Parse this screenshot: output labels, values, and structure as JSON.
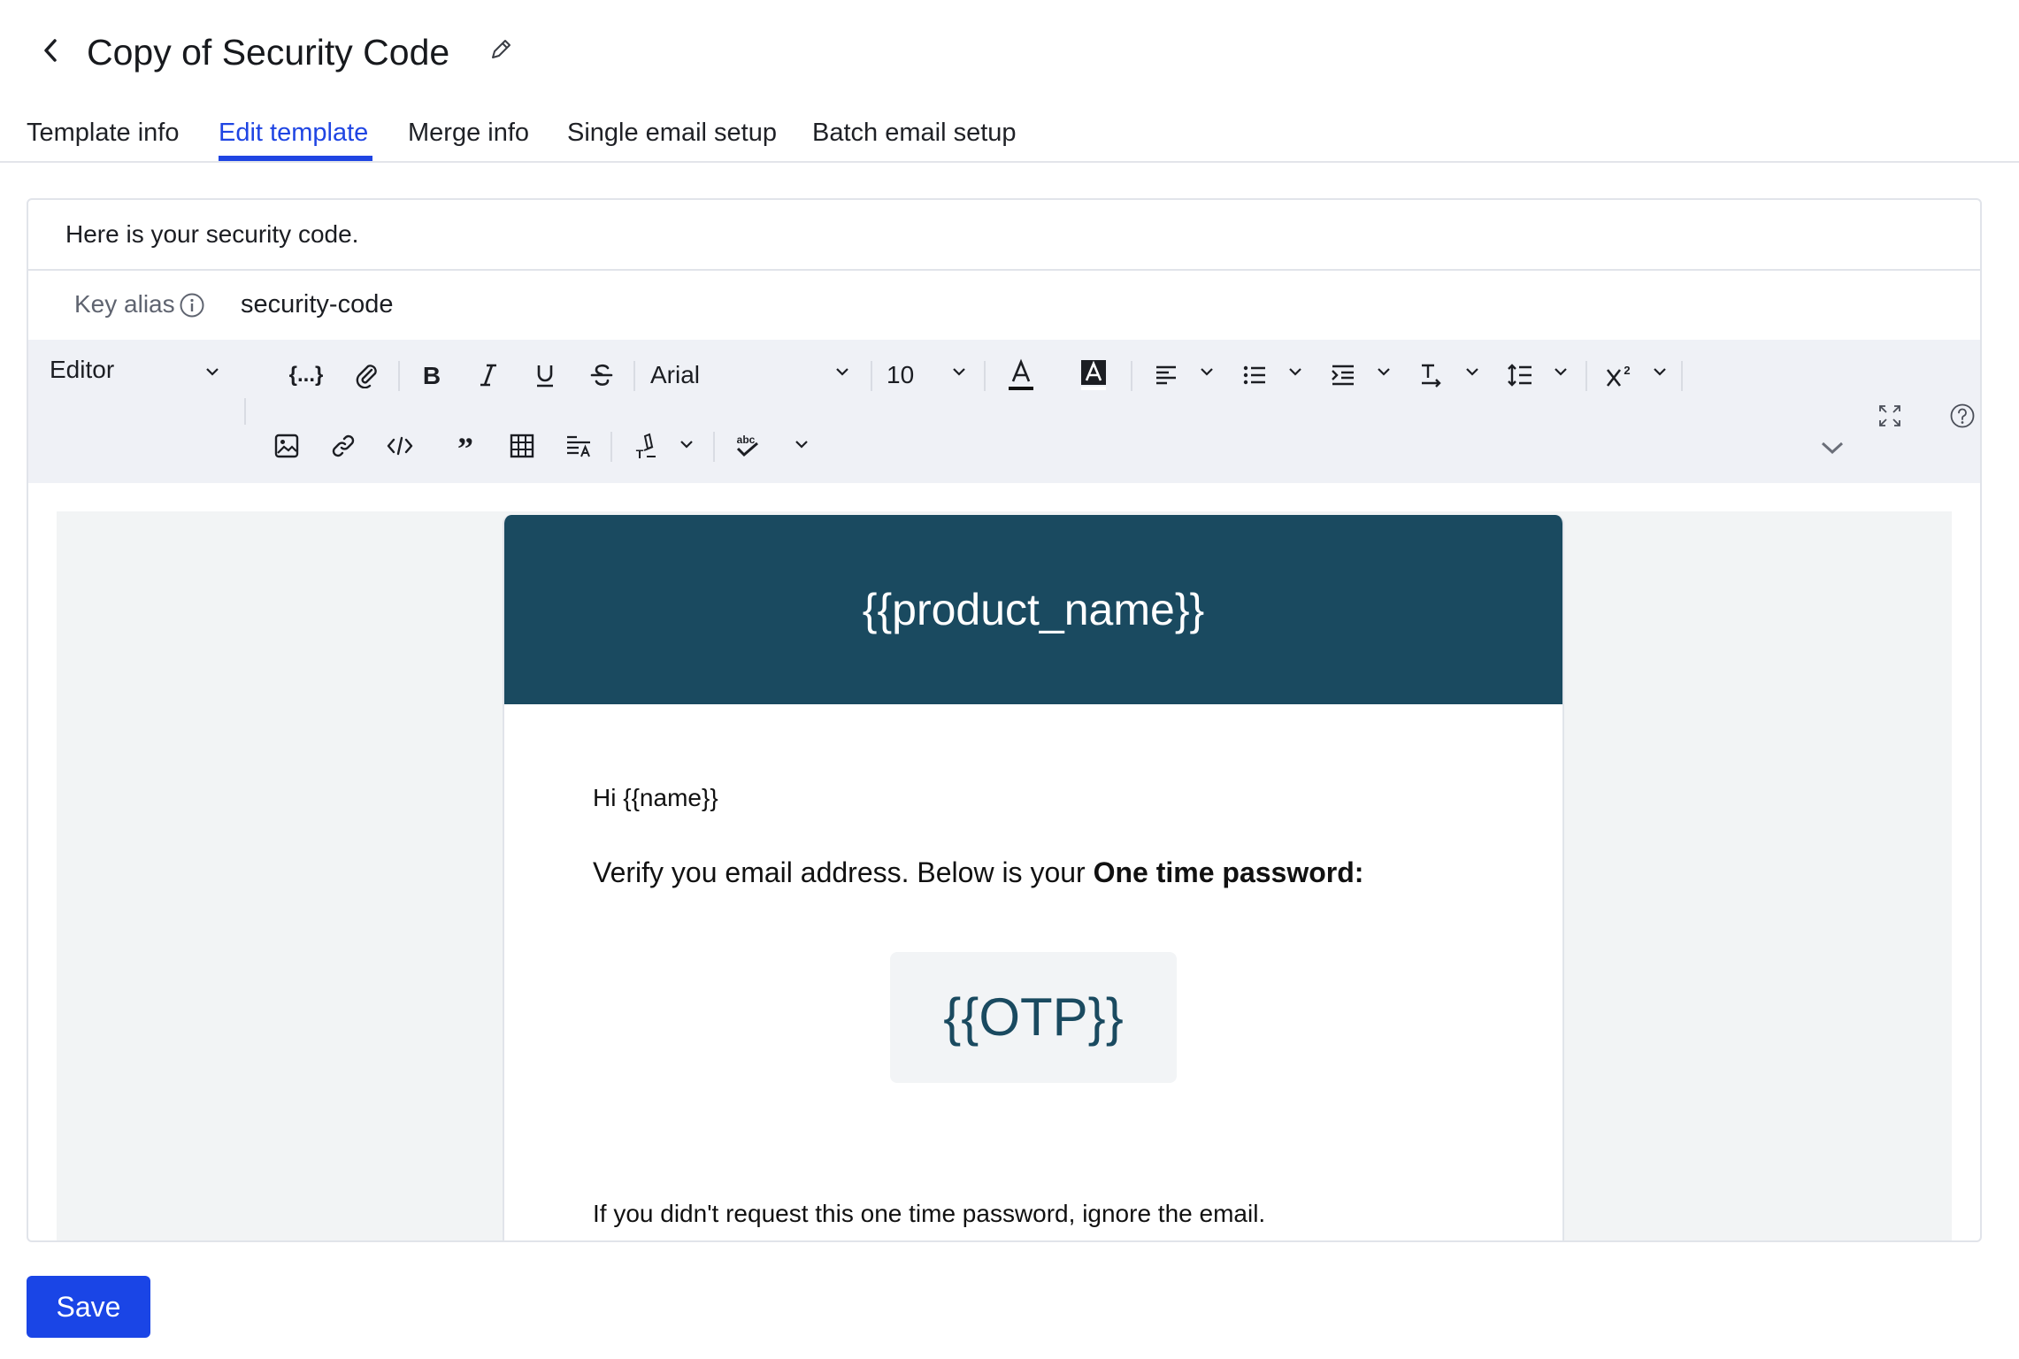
{
  "header": {
    "title": "Copy of Security Code"
  },
  "tabs": [
    {
      "label": "Template info"
    },
    {
      "label": "Edit template"
    },
    {
      "label": "Merge info"
    },
    {
      "label": "Single email setup"
    },
    {
      "label": "Batch email setup"
    }
  ],
  "editor": {
    "subject": "Here is your security code.",
    "alias_label": "Key alias",
    "alias_value": "security-code"
  },
  "toolbar": {
    "mode": "Editor",
    "font": "Arial",
    "size": "10"
  },
  "email": {
    "product_name": "{{product_name}}",
    "greeting": "Hi {{name}}",
    "verify_text": "Verify you email address. Below is your ",
    "verify_bold": "One time password:",
    "otp": "{{OTP}}",
    "ignore_text": "If you didn't request this one time password, ignore the email."
  },
  "footer": {
    "save_label": "Save"
  },
  "colors": {
    "accent": "#1f45e3",
    "email_header": "#1a4a60",
    "save_button": "#1a45e6"
  }
}
